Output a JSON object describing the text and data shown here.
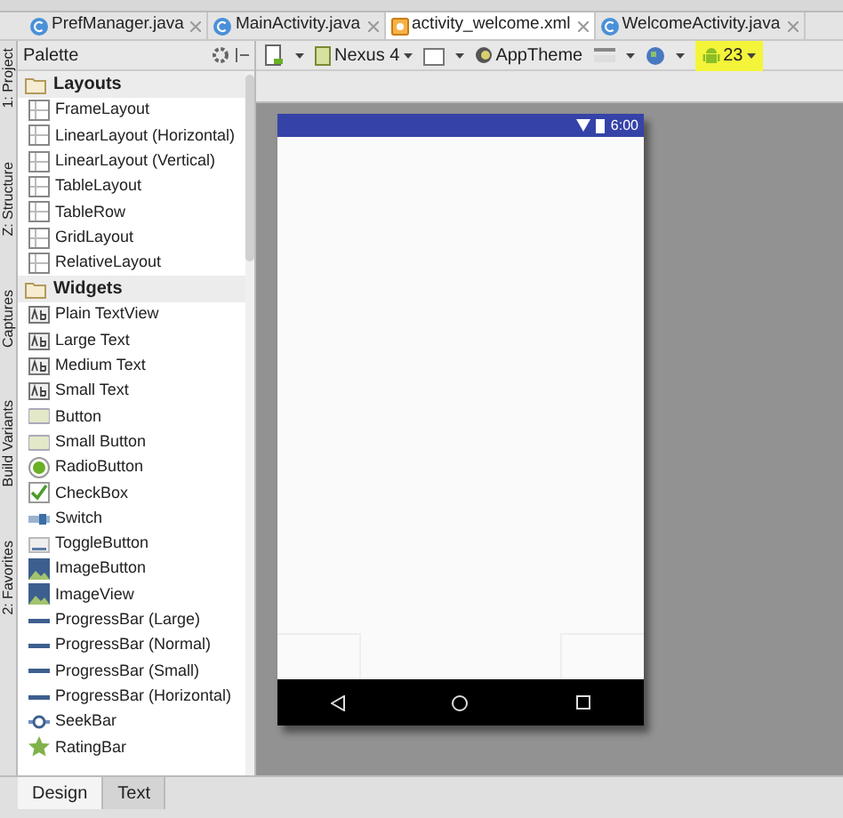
{
  "editor_tabs": [
    {
      "label": "PrefManager.java",
      "kind": "java",
      "selected": false
    },
    {
      "label": "MainActivity.java",
      "kind": "java",
      "selected": false
    },
    {
      "label": "activity_welcome.xml",
      "kind": "xml",
      "selected": true
    },
    {
      "label": "WelcomeActivity.java",
      "kind": "java",
      "selected": false
    }
  ],
  "tool_strip": [
    "1: Project",
    "Z: Structure",
    "Captures",
    "Build Variants",
    "2: Favorites"
  ],
  "palette": {
    "title": "Palette",
    "groups": [
      {
        "label": "Layouts",
        "items": [
          {
            "label": "FrameLayout",
            "kind": "layout"
          },
          {
            "label": "LinearLayout (Horizontal)",
            "kind": "layout"
          },
          {
            "label": "LinearLayout (Vertical)",
            "kind": "layout"
          },
          {
            "label": "TableLayout",
            "kind": "layout"
          },
          {
            "label": "TableRow",
            "kind": "layout"
          },
          {
            "label": "GridLayout",
            "kind": "layout"
          },
          {
            "label": "RelativeLayout",
            "kind": "layout"
          }
        ]
      },
      {
        "label": "Widgets",
        "items": [
          {
            "label": "Plain TextView",
            "kind": "text"
          },
          {
            "label": "Large Text",
            "kind": "text"
          },
          {
            "label": "Medium Text",
            "kind": "text"
          },
          {
            "label": "Small Text",
            "kind": "text"
          },
          {
            "label": "Button",
            "kind": "button"
          },
          {
            "label": "Small Button",
            "kind": "button"
          },
          {
            "label": "RadioButton",
            "kind": "radio"
          },
          {
            "label": "CheckBox",
            "kind": "checkbox"
          },
          {
            "label": "Switch",
            "kind": "switch"
          },
          {
            "label": "ToggleButton",
            "kind": "toggle"
          },
          {
            "label": "ImageButton",
            "kind": "image"
          },
          {
            "label": "ImageView",
            "kind": "image"
          },
          {
            "label": "ProgressBar (Large)",
            "kind": "progress"
          },
          {
            "label": "ProgressBar (Normal)",
            "kind": "progress"
          },
          {
            "label": "ProgressBar (Small)",
            "kind": "progress"
          },
          {
            "label": "ProgressBar (Horizontal)",
            "kind": "progress"
          },
          {
            "label": "SeekBar",
            "kind": "seekbar"
          },
          {
            "label": "RatingBar",
            "kind": "rating"
          }
        ]
      }
    ]
  },
  "toolbar": {
    "device": "Nexus 4",
    "theme": "AppTheme",
    "api": "23"
  },
  "phone": {
    "time": "6:00"
  },
  "bottom_tabs": [
    {
      "label": "Design",
      "selected": true
    },
    {
      "label": "Text",
      "selected": false
    }
  ]
}
